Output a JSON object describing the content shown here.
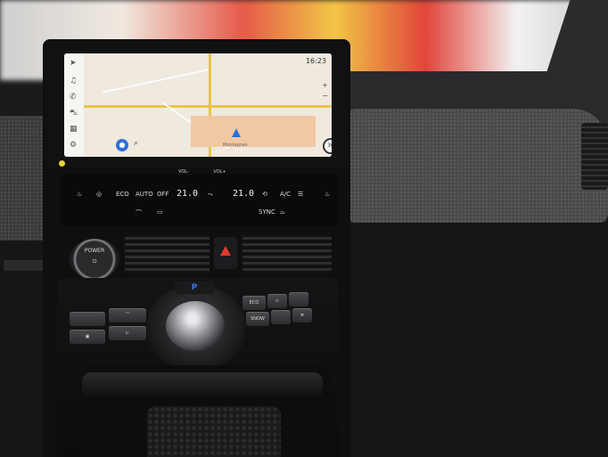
{
  "scene": {
    "infotainment": {
      "status_time": "16:23",
      "map_label": "Montagnes",
      "speed_limit": "30",
      "rail_icons": [
        "navigation-icon",
        "music-icon",
        "phone-icon",
        "car-icon",
        "apps-icon",
        "settings-icon"
      ]
    },
    "climate_panel": {
      "vol_minus_label": "VOL-",
      "vol_plus_label": "VOL+",
      "eco_label": "ECO",
      "auto_label": "AUTO",
      "off_label": "OFF",
      "ac_label": "A/C",
      "sync_label": "SYNC",
      "left_temp": "21.0",
      "right_temp": "21.0"
    },
    "power_button": {
      "label": "POWER"
    },
    "gear_selector": {
      "park_label": "P"
    },
    "drive_mode_buttons": {
      "eco_label": "ECO",
      "snow_label": "SNOW"
    },
    "colors": {
      "hazard": "#e03a2c",
      "park_indicator": "#3e78e0",
      "map_road": "#e9c44a",
      "mic_button": "#2f6fd8"
    }
  }
}
